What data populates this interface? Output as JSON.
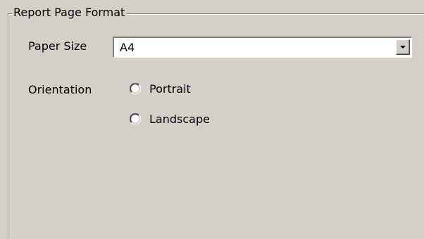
{
  "group": {
    "title": "Report Page Format"
  },
  "paper_size": {
    "label": "Paper Size",
    "value": "A4"
  },
  "orientation": {
    "label": "Orientation",
    "options": [
      {
        "label": "Portrait",
        "selected": false
      },
      {
        "label": "Landscape",
        "selected": false
      }
    ]
  },
  "colors": {
    "background": "#d4d0c8",
    "field": "#ffffff",
    "shadow": "#808080",
    "highlight": "#ffffff"
  }
}
